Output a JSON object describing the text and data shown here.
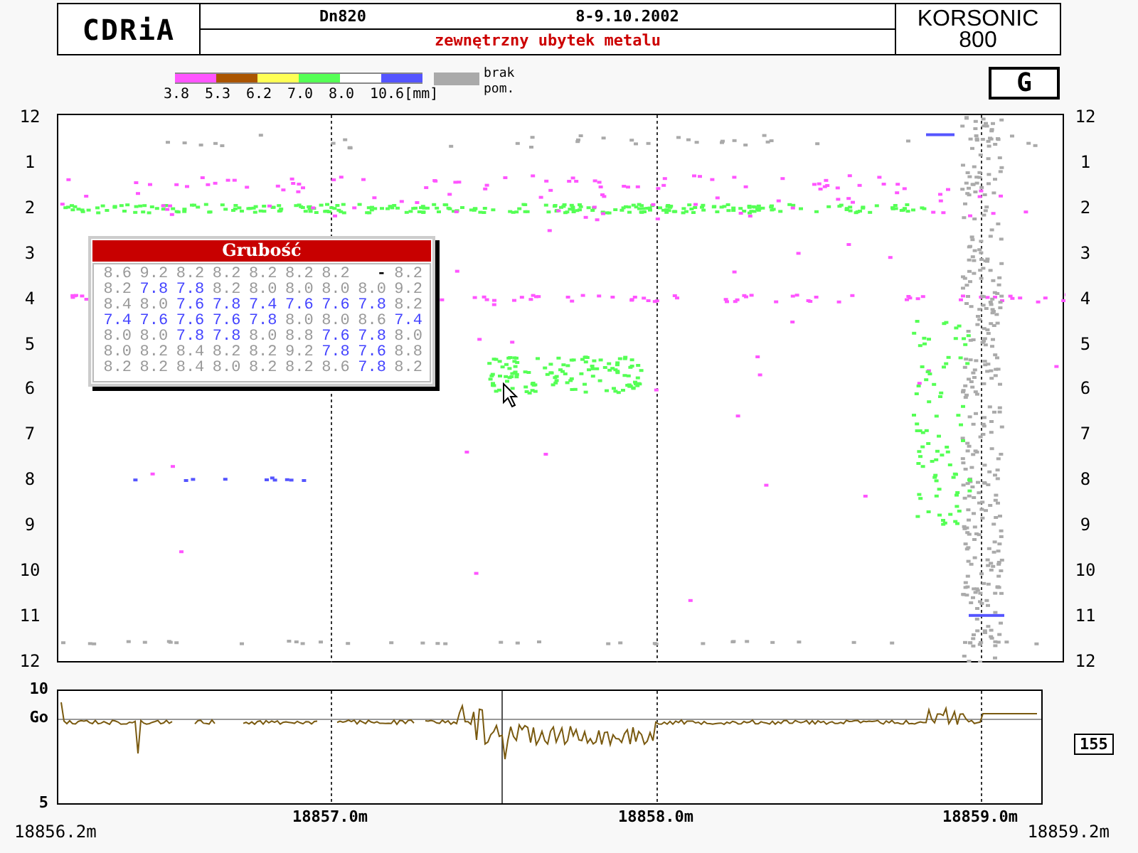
{
  "header": {
    "logo": "CDRiA",
    "diameter": "Dn820",
    "date": "8-9.10.2002",
    "defect_type": "zewnętrzny ubytek metalu",
    "device": [
      "KORSONIC",
      "800"
    ]
  },
  "legend": {
    "items": [
      {
        "color": "#ff55ff",
        "label": "3.8"
      },
      {
        "color": "#aa5500",
        "label": "5.3"
      },
      {
        "color": "#ffff55",
        "label": "6.2"
      },
      {
        "color": "#55ff55",
        "label": "7.0"
      },
      {
        "color": "#ffffff",
        "label": "8.0"
      },
      {
        "color": "#5555ff",
        "label": "10.6[mm]"
      }
    ],
    "no_data": {
      "color": "#aaaaaa",
      "lines": [
        "brak",
        "pom."
      ]
    }
  },
  "mode_badge": "G",
  "map": {
    "left_axis": [
      "12",
      "1",
      "2",
      "3",
      "4",
      "5",
      "6",
      "7",
      "8",
      "9",
      "10",
      "11",
      "12"
    ],
    "right_axis": [
      "12",
      "1",
      "2",
      "3",
      "4",
      "5",
      "6",
      "7",
      "8",
      "9",
      "10",
      "11",
      "12"
    ]
  },
  "popup": {
    "title": "Grubość",
    "rows": [
      [
        {
          "text": "8.6",
          "highlighted": false
        },
        {
          "text": "9.2",
          "highlighted": false
        },
        {
          "text": "8.2",
          "highlighted": false
        },
        {
          "text": "8.2",
          "highlighted": false
        },
        {
          "text": "8.2",
          "highlighted": false
        },
        {
          "text": "8.2",
          "highlighted": false
        },
        {
          "text": "8.2",
          "highlighted": false
        },
        {
          "text": "-",
          "highlighted": false
        },
        {
          "text": "8.2",
          "highlighted": false
        }
      ],
      [
        {
          "text": "8.2",
          "highlighted": false
        },
        {
          "text": "7.8",
          "highlighted": true
        },
        {
          "text": "7.8",
          "highlighted": true
        },
        {
          "text": "8.2",
          "highlighted": false
        },
        {
          "text": "8.0",
          "highlighted": false
        },
        {
          "text": "8.0",
          "highlighted": false
        },
        {
          "text": "8.0",
          "highlighted": false
        },
        {
          "text": "8.0",
          "highlighted": false
        },
        {
          "text": "9.2",
          "highlighted": false
        }
      ],
      [
        {
          "text": "8.4",
          "highlighted": false
        },
        {
          "text": "8.0",
          "highlighted": false
        },
        {
          "text": "7.6",
          "highlighted": true
        },
        {
          "text": "7.8",
          "highlighted": true
        },
        {
          "text": "7.4",
          "highlighted": true
        },
        {
          "text": "7.6",
          "highlighted": true
        },
        {
          "text": "7.6",
          "highlighted": true
        },
        {
          "text": "7.8",
          "highlighted": true
        },
        {
          "text": "8.2",
          "highlighted": false
        }
      ],
      [
        {
          "text": "7.4",
          "highlighted": true
        },
        {
          "text": "7.6",
          "highlighted": true
        },
        {
          "text": "7.6",
          "highlighted": true
        },
        {
          "text": "7.6",
          "highlighted": true
        },
        {
          "text": "7.8",
          "highlighted": true
        },
        {
          "text": "8.0",
          "highlighted": false
        },
        {
          "text": "8.0",
          "highlighted": false
        },
        {
          "text": "8.6",
          "highlighted": false
        },
        {
          "text": "7.4",
          "highlighted": true
        }
      ],
      [
        {
          "text": "8.0",
          "highlighted": false
        },
        {
          "text": "8.0",
          "highlighted": false
        },
        {
          "text": "7.8",
          "highlighted": true
        },
        {
          "text": "7.8",
          "highlighted": true
        },
        {
          "text": "8.0",
          "highlighted": false
        },
        {
          "text": "8.8",
          "highlighted": false
        },
        {
          "text": "7.6",
          "highlighted": true
        },
        {
          "text": "7.8",
          "highlighted": true
        },
        {
          "text": "8.0",
          "highlighted": false
        }
      ],
      [
        {
          "text": "8.0",
          "highlighted": false
        },
        {
          "text": "8.2",
          "highlighted": false
        },
        {
          "text": "8.4",
          "highlighted": false
        },
        {
          "text": "8.2",
          "highlighted": false
        },
        {
          "text": "8.2",
          "highlighted": false
        },
        {
          "text": "9.2",
          "highlighted": false
        },
        {
          "text": "7.8",
          "highlighted": true
        },
        {
          "text": "7.6",
          "highlighted": true
        },
        {
          "text": "8.8",
          "highlighted": false
        }
      ],
      [
        {
          "text": "8.2",
          "highlighted": false
        },
        {
          "text": "8.2",
          "highlighted": false
        },
        {
          "text": "8.4",
          "highlighted": false
        },
        {
          "text": "8.0",
          "highlighted": false
        },
        {
          "text": "8.2",
          "highlighted": false
        },
        {
          "text": "8.2",
          "highlighted": false
        },
        {
          "text": "8.6",
          "highlighted": false
        },
        {
          "text": "7.8",
          "highlighted": true
        },
        {
          "text": "8.2",
          "highlighted": false
        }
      ]
    ]
  },
  "trace": {
    "y_labels": [
      "10",
      "Go",
      "5"
    ],
    "reading": "155"
  },
  "x_axis": {
    "ticks": [
      "18857.0m",
      "18858.0m",
      "18859.0m"
    ],
    "start": "18856.2m",
    "end": "18859.2m"
  }
}
